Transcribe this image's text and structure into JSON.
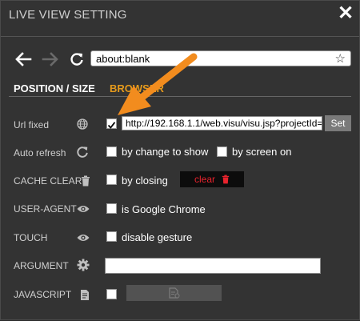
{
  "window": {
    "title": "LIVE VIEW SETTING",
    "close_icon": "close-icon"
  },
  "navbar": {
    "back_icon": "arrow-left-icon",
    "forward_icon": "arrow-right-icon",
    "reload_icon": "reload-icon",
    "address": "about:blank",
    "bookmark_icon": "star-icon"
  },
  "tabs": [
    {
      "label": "POSITION / SIZE",
      "active": false
    },
    {
      "label": "BROWSER",
      "active": true
    }
  ],
  "rows": {
    "url_fixed": {
      "label": "Url fixed",
      "icon": "globe-icon",
      "checked": true,
      "value": "http://192.168.1.1/web.visu/visu.jsp?projectId=",
      "set_label": "Set"
    },
    "auto_refresh": {
      "label": "Auto refresh",
      "icon": "refresh-icon",
      "options": [
        {
          "label": "by change to show",
          "checked": false
        },
        {
          "label": "by screen on",
          "checked": false
        }
      ]
    },
    "cache_clear": {
      "label": "CACHE CLEAR",
      "icon": "trash-icon",
      "option_label": "by closing",
      "checked": false,
      "clear_label": "clear"
    },
    "user_agent": {
      "label": "USER-AGENT",
      "icon": "eye-icon",
      "option_label": "is Google Chrome",
      "checked": false
    },
    "touch": {
      "label": "TOUCH",
      "icon": "eye-icon",
      "option_label": "disable gesture",
      "checked": false
    },
    "argument": {
      "label": "ARGUMENT",
      "icon": "gear-icon",
      "value": ""
    },
    "javascript": {
      "label": "JAVASCRIPT",
      "icon": "document-icon",
      "checked": false
    }
  },
  "colors": {
    "background": "#333333",
    "accent": "#e59a1c",
    "annotation_arrow": "#f28c1e",
    "clear_text": "#e8232d"
  }
}
